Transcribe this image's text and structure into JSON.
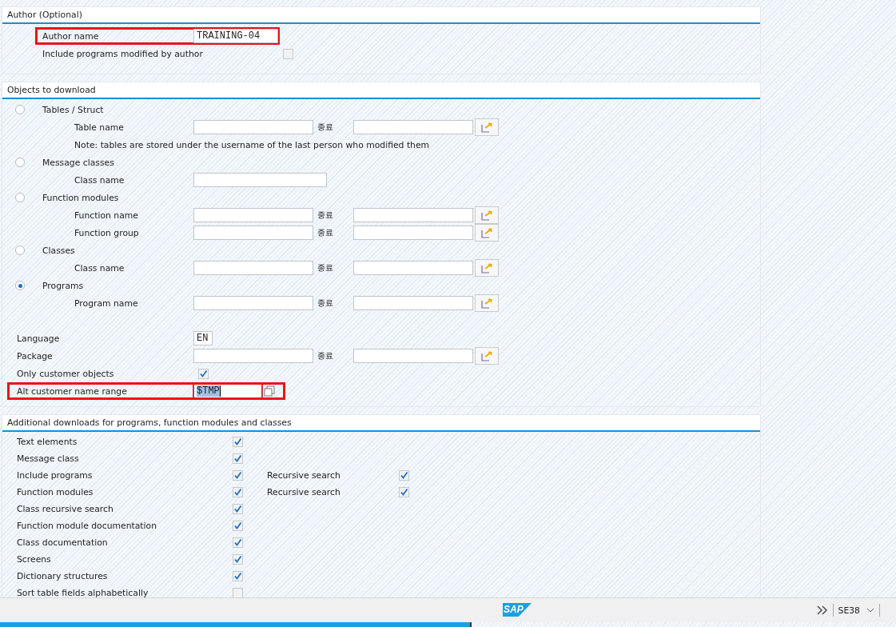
{
  "author_section": {
    "title": "Author (Optional)",
    "rows": [
      {
        "kind": "input",
        "label": "Author name",
        "value": "TRAINING-04",
        "highlighted": true
      },
      {
        "kind": "checkbox",
        "label": "Include programs modified by author",
        "checked": false
      }
    ]
  },
  "objects_section": {
    "title": "Objects to download",
    "groups": [
      {
        "label": "Tables / Struct",
        "selected": false,
        "rows": [
          {
            "kind": "range",
            "label": "Table name",
            "to_label": "종료"
          },
          {
            "kind": "note",
            "label": "Note: tables are stored under the username of the last person who modified them"
          }
        ]
      },
      {
        "label": "Message classes",
        "selected": false,
        "rows": [
          {
            "kind": "input",
            "label": "Class name"
          }
        ]
      },
      {
        "label": "Function modules",
        "selected": false,
        "rows": [
          {
            "kind": "range",
            "label": "Function name",
            "to_label": "종료"
          },
          {
            "kind": "range",
            "label": "Function group",
            "to_label": "종료"
          }
        ]
      },
      {
        "label": "Classes",
        "selected": false,
        "rows": [
          {
            "kind": "range",
            "label": "Class name",
            "to_label": "종료"
          }
        ]
      },
      {
        "label": "Programs",
        "selected": true,
        "rows": [
          {
            "kind": "range",
            "label": "Program name",
            "to_label": "종료"
          }
        ]
      }
    ],
    "options": [
      {
        "kind": "short",
        "label": "Language",
        "value": "EN"
      },
      {
        "kind": "range",
        "label": "Package",
        "to_label": "종료"
      },
      {
        "kind": "checkbox",
        "label": "Only customer objects",
        "checked": true
      },
      {
        "kind": "search",
        "label": "Alt customer name range",
        "value": "$TMP",
        "highlighted": true
      }
    ]
  },
  "downloads_section": {
    "title": "Additional downloads for programs, function modules and classes",
    "rows": [
      {
        "label": "Text elements",
        "checked": true
      },
      {
        "label": "Message class",
        "checked": true
      },
      {
        "label": "Include programs",
        "checked": true,
        "sub": {
          "label": "Recursive search",
          "checked": true
        }
      },
      {
        "label": "Function modules",
        "checked": true,
        "sub": {
          "label": "Recursive search",
          "checked": true
        }
      },
      {
        "label": "Class recursive search",
        "checked": true
      },
      {
        "label": "Function module documentation",
        "checked": true
      },
      {
        "label": "Class documentation",
        "checked": true
      },
      {
        "label": "Screens",
        "checked": true
      },
      {
        "label": "Dictionary structures",
        "checked": true
      },
      {
        "label": "Sort table fields alphabetically",
        "checked": false
      }
    ]
  },
  "status_bar": {
    "logo": "SAP",
    "transaction": "SE38"
  }
}
